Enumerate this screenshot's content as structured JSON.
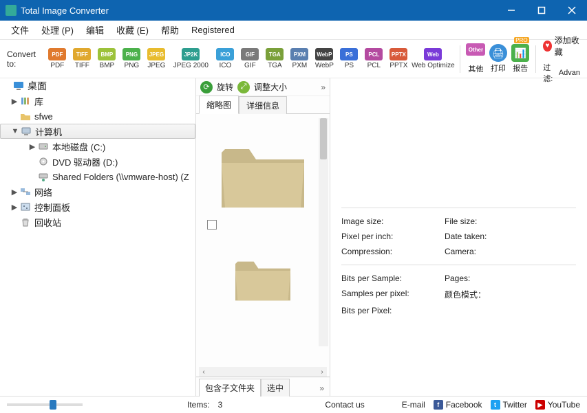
{
  "window": {
    "title": "Total Image Converter"
  },
  "menu": {
    "file": "文件",
    "process": "处理 (P)",
    "edit": "编辑",
    "favorites": "收藏 (E)",
    "help": "帮助",
    "registered": "Registered"
  },
  "toolbar": {
    "convert_to": "Convert to:",
    "formats": [
      {
        "abbr": "PDF",
        "label": "PDF",
        "color": "#e07a2e"
      },
      {
        "abbr": "TIFF",
        "label": "TIFF",
        "color": "#e0a82e"
      },
      {
        "abbr": "BMP",
        "label": "BMP",
        "color": "#9cc23a"
      },
      {
        "abbr": "PNG",
        "label": "PNG",
        "color": "#4bb14b"
      },
      {
        "abbr": "JPEG",
        "label": "JPEG",
        "color": "#e8bc2e"
      },
      {
        "abbr": "JP2K",
        "label": "JPEG 2000",
        "color": "#2e9e8f",
        "wide": true
      },
      {
        "abbr": "ICO",
        "label": "ICO",
        "color": "#3aa0d8"
      },
      {
        "abbr": "GIF",
        "label": "GIF",
        "color": "#7a7a7a"
      },
      {
        "abbr": "TGA",
        "label": "TGA",
        "color": "#7aa03a"
      },
      {
        "abbr": "PXM",
        "label": "PXM",
        "color": "#5a7fb0"
      },
      {
        "abbr": "WebP",
        "label": "WebP",
        "color": "#444"
      },
      {
        "abbr": "PS",
        "label": "PS",
        "color": "#3a6fd8"
      },
      {
        "abbr": "PCL",
        "label": "PCL",
        "color": "#b44aa0"
      },
      {
        "abbr": "PPTX",
        "label": "PPTX",
        "color": "#d85a3a"
      },
      {
        "abbr": "Web",
        "label": "Web Optimize",
        "color": "#7a3ad8",
        "wide": true
      }
    ],
    "other": "其他",
    "print": "打印",
    "report": "报告",
    "add_fav": "添加收藏",
    "filter": "过滤:",
    "filter_value": "Advan"
  },
  "tree": {
    "root": "桌面",
    "nodes": [
      {
        "label": "库",
        "icon": "library",
        "tw": "▶",
        "lvl": 1
      },
      {
        "label": "sfwe",
        "icon": "folder-user",
        "tw": "",
        "lvl": 1
      },
      {
        "label": "计算机",
        "icon": "computer",
        "tw": "▼",
        "lvl": 1,
        "selected": true
      },
      {
        "label": "本地磁盘 (C:)",
        "icon": "disk",
        "tw": "▶",
        "lvl": 2
      },
      {
        "label": "DVD 驱动器 (D:)",
        "icon": "dvd",
        "tw": "",
        "lvl": 2
      },
      {
        "label": "Shared Folders (\\\\vmware-host) (Z",
        "icon": "netdrive",
        "tw": "",
        "lvl": 2
      },
      {
        "label": "网络",
        "icon": "network",
        "tw": "▶",
        "lvl": 1
      },
      {
        "label": "控制面板",
        "icon": "control",
        "tw": "▶",
        "lvl": 1
      },
      {
        "label": "回收站",
        "icon": "recycle",
        "tw": "",
        "lvl": 1
      }
    ]
  },
  "center": {
    "rotate": "旋转",
    "resize": "调整大小",
    "tab_thumb": "缩略图",
    "tab_detail": "详细信息",
    "subfolders": "包含子文件夹",
    "checked": "选中"
  },
  "details": {
    "image_size": "Image size:",
    "file_size": "File size:",
    "ppi": "Pixel per inch:",
    "date_taken": "Date taken:",
    "compression": "Compression:",
    "camera": "Camera:",
    "bps": "Bits per Sample:",
    "pages": "Pages:",
    "spp": "Samples per pixel:",
    "color_mode": "颜色模式：",
    "bpp": "Bits per Pixel:"
  },
  "status": {
    "items_label": "Items:",
    "items_count": "3",
    "contact": "Contact us",
    "email": "E-mail",
    "facebook": "Facebook",
    "twitter": "Twitter",
    "youtube": "YouTube"
  }
}
